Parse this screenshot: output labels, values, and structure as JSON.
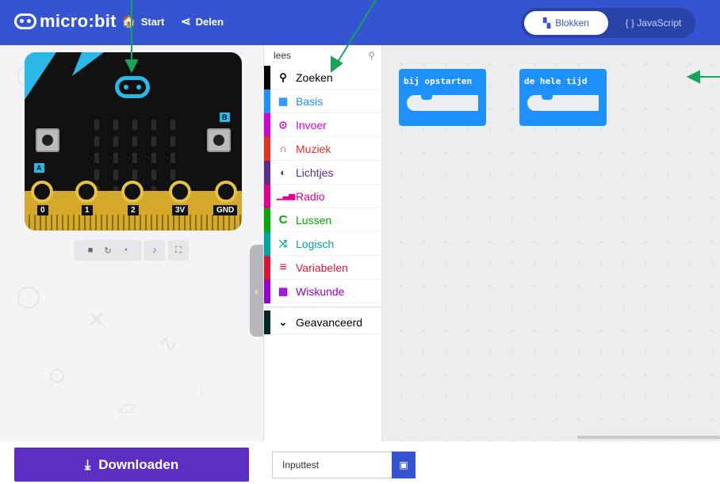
{
  "header": {
    "logo_text": "micro:bit",
    "nav_start": "Start",
    "nav_share": "Delen",
    "toggle_blocks": "Blokken",
    "toggle_js": "{ } JavaScript"
  },
  "simulator": {
    "button_a": "A",
    "button_b": "B",
    "pins": [
      "0",
      "1",
      "2",
      "3V",
      "GND"
    ]
  },
  "toolbox": {
    "search_value": "lees",
    "categories": [
      {
        "label": "Zoeken",
        "color": "#000000",
        "icon": "search-icon",
        "glyph": "🔍"
      },
      {
        "label": "Basis",
        "color": "#1e90ff",
        "icon": "grid-icon",
        "glyph": "▦"
      },
      {
        "label": "Invoer",
        "color": "#d400d4",
        "icon": "target-icon",
        "glyph": "⊙"
      },
      {
        "label": "Muziek",
        "color": "#e63022",
        "icon": "headphones-icon",
        "glyph": "♫"
      },
      {
        "label": "Lichtjes",
        "color": "#5c2d91",
        "icon": "toggle-icon",
        "glyph": "◐"
      },
      {
        "label": "Radio",
        "color": "#e3008c",
        "icon": "signal-icon",
        "glyph": "▂▄▆"
      },
      {
        "label": "Lussen",
        "color": "#00aa00",
        "icon": "loop-icon",
        "glyph": "C"
      },
      {
        "label": "Logisch",
        "color": "#00a4a6",
        "icon": "shuffle-icon",
        "glyph": "⤮"
      },
      {
        "label": "Variabelen",
        "color": "#dc143c",
        "icon": "list-icon",
        "glyph": "≡"
      },
      {
        "label": "Wiskunde",
        "color": "#9400d3",
        "icon": "calculator-icon",
        "glyph": "▦"
      }
    ],
    "advanced_label": "Geavanceerd",
    "advanced_color": "#00272b"
  },
  "workspace": {
    "block_on_start": "bij opstarten",
    "block_forever": "de hele tijd",
    "block_color": "#1e90ff"
  },
  "footer": {
    "download_label": "Downloaden",
    "project_name": "Inputtest"
  },
  "colors": {
    "header": "#3454d1",
    "download": "#5c2fc2",
    "annotation_arrow": "#1aa35a"
  }
}
